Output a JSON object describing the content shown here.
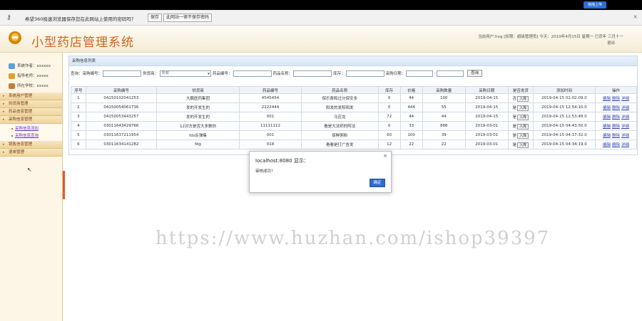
{
  "browser": {
    "upload_button": "拖拽上传"
  },
  "password_bar": {
    "message": "希望360极速浏览器保存您在此网站上使用的密码吗？",
    "save_label": "保存",
    "never_label": "此网站一律不保存密码",
    "close_glyph": "×"
  },
  "header": {
    "title": "小型药店管理系统",
    "user_info": "当前用户:hog [权限：超级管理员] 今天：2019年4月15日 星期一 已农年 三月十一",
    "logout": "退出"
  },
  "sidebar": {
    "info": [
      {
        "label": "系统作者：xxxxxx",
        "icon": "system-icon",
        "color": "#5aa0d8"
      },
      {
        "label": "指导老师：xxxxx",
        "icon": "teacher-icon",
        "color": "#e0a030"
      },
      {
        "label": "所在学校：xxxxx",
        "icon": "school-icon",
        "color": "#c0803a"
      }
    ],
    "menu": [
      {
        "label": "系统用户管理"
      },
      {
        "label": "供货商管理"
      },
      {
        "label": "药品信息管理"
      },
      {
        "label": "采购信息管理"
      }
    ],
    "submenu": [
      {
        "label": "采购信息添加"
      },
      {
        "label": "采购信息查询"
      }
    ],
    "menu_after": [
      {
        "label": "销售信息管理"
      },
      {
        "label": "退单管理"
      }
    ]
  },
  "panel": {
    "title": "采购信息列表",
    "search": {
      "label_query": "查询：采购编号：",
      "label_supplier": "供货商：",
      "supplier_selected": "所有",
      "label_drug_no": "药品编号：",
      "label_drug_name": "药品名称：",
      "label_stock": "库存：",
      "label_date": "采购日期：",
      "date_sep": "-",
      "query_button": "查询"
    },
    "columns": [
      "序号",
      "采购编号",
      "供货商",
      "药品编号",
      "药品名称",
      "库存",
      "价格",
      "采购数量",
      "采购日期",
      "是否发货",
      "添加时间",
      "操作"
    ],
    "rows": [
      {
        "no": "1",
        "pid": "04150102041253",
        "supplier": "大鹏医药集团",
        "drug_no": "4545454",
        "drug_name": "保乐费和过分保安多",
        "stock": "0",
        "price": "44",
        "qty": "100",
        "date": "2019-04-15",
        "shipped": "否",
        "added": "2019-04-15 01:02:09.0"
      },
      {
        "no": "2",
        "pid": "04150054061736",
        "supplier": "发的开发生的",
        "drug_no": "2222444",
        "drug_name": "阳发的发阳阳发",
        "stock": "0",
        "price": "444",
        "qty": "55",
        "date": "2019-04-15",
        "shipped": "是",
        "added": "2019-04-15 12:54:10.0"
      },
      {
        "no": "3",
        "pid": "04150053443257",
        "supplier": "发的开发生的",
        "drug_no": "001",
        "drug_name": "马应龙",
        "stock": "72",
        "price": "44",
        "qty": "44",
        "date": "2019-04-15",
        "shipped": "是",
        "added": "2019-04-15 12:53:48.0"
      },
      {
        "no": "4",
        "pid": "03011643429766",
        "supplier": "12对方是否大多数你",
        "drug_no": "11111112",
        "drug_name": "看是大法师的阿法",
        "stock": "0",
        "price": "33",
        "qty": "888",
        "date": "2019-03-01",
        "shipped": "是",
        "added": "2019-04-15 04:43:50.0"
      },
      {
        "no": "5",
        "pid": "03011637211954",
        "supplier": "fds反弹集",
        "drug_no": "001",
        "drug_name": "保鲜粥粉",
        "stock": "60",
        "price": "100",
        "qty": "39",
        "date": "2019-03-01",
        "shipped": "是",
        "added": "2019-04-15 04:37:32.0"
      },
      {
        "no": "6",
        "pid": "03011634141282",
        "supplier": "fdg",
        "drug_no": "018",
        "drug_name": "看看是打广告发",
        "stock": "12",
        "price": "22",
        "qty": "22",
        "date": "2019-03-01",
        "shipped": "是",
        "added": "2019-04-15 04:34:19.0"
      }
    ],
    "in_button": "入库",
    "ops": {
      "edit": "编辑",
      "delete": "删除",
      "detail": "详细"
    }
  },
  "watermark": "https://www.huzhan.com/ishop39397",
  "dialog": {
    "title": "localhost:8080 显示：",
    "message": "审核成功！",
    "ok": "确定",
    "close": "×"
  }
}
